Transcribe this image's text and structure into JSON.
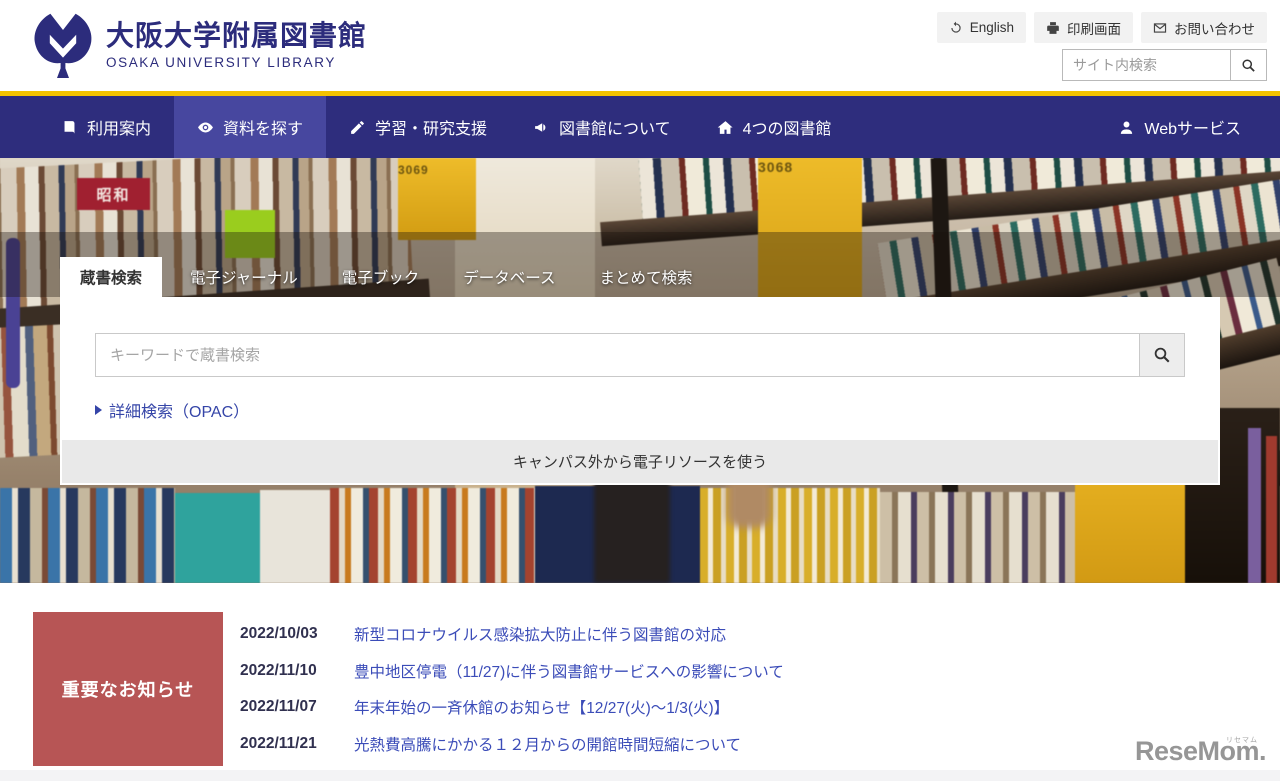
{
  "header": {
    "logo_title": "大阪大学附属図書館",
    "logo_subtitle": "OSAKA UNIVERSITY LIBRARY",
    "utility": [
      {
        "label": "English",
        "icon": "sync-icon"
      },
      {
        "label": "印刷画面",
        "icon": "printer-icon"
      },
      {
        "label": "お問い合わせ",
        "icon": "mail-icon"
      }
    ],
    "site_search_placeholder": "サイト内検索"
  },
  "nav": {
    "items": [
      {
        "label": "利用案内",
        "icon": "book-icon",
        "active": false
      },
      {
        "label": "資料を探す",
        "icon": "eye-icon",
        "active": true
      },
      {
        "label": "学習・研究支援",
        "icon": "pencil-icon",
        "active": false
      },
      {
        "label": "図書館について",
        "icon": "megaphone-icon",
        "active": false
      },
      {
        "label": "4つの図書館",
        "icon": "home-icon",
        "active": false
      }
    ],
    "web_service": {
      "label": "Webサービス",
      "icon": "user-icon"
    }
  },
  "hero": {
    "shelf_label_left": "3069",
    "shelf_label_right": "3068",
    "book_spine_label": "昭和",
    "tabs": [
      {
        "label": "蔵書検索",
        "active": true
      },
      {
        "label": "電子ジャーナル",
        "active": false
      },
      {
        "label": "電子ブック",
        "active": false
      },
      {
        "label": "データベース",
        "active": false
      },
      {
        "label": "まとめて検索",
        "active": false
      }
    ],
    "search_placeholder": "キーワードで蔵書検索",
    "advanced_link": "詳細検索（OPAC）",
    "offcampus_button": "キャンパス外から電子リソースを使う"
  },
  "news": {
    "heading": "重要なお知らせ",
    "items": [
      {
        "date": "2022/10/03",
        "title": "新型コロナウイルス感染拡大防止に伴う図書館の対応"
      },
      {
        "date": "2022/11/10",
        "title": "豊中地区停電（11/27)に伴う図書館サービスへの影響について"
      },
      {
        "date": "2022/11/07",
        "title": "年末年始の一斉休館のお知らせ【12/27(火)〜1/3(火)】"
      },
      {
        "date": "2022/11/21",
        "title": "光熱費高騰にかかる１２月からの開館時間短縮について"
      }
    ]
  },
  "watermark": {
    "text": "ReseMom.",
    "ruby": "リセマム"
  },
  "colors": {
    "navy_logo": "#2c2c7c",
    "nav_bg": "#2e2d7d",
    "nav_active": "#47479f",
    "accent_yellow": "#f3c200",
    "link_blue": "#3b4cb8",
    "news_red": "#b75555",
    "panel_gray": "#e9e9e9"
  }
}
